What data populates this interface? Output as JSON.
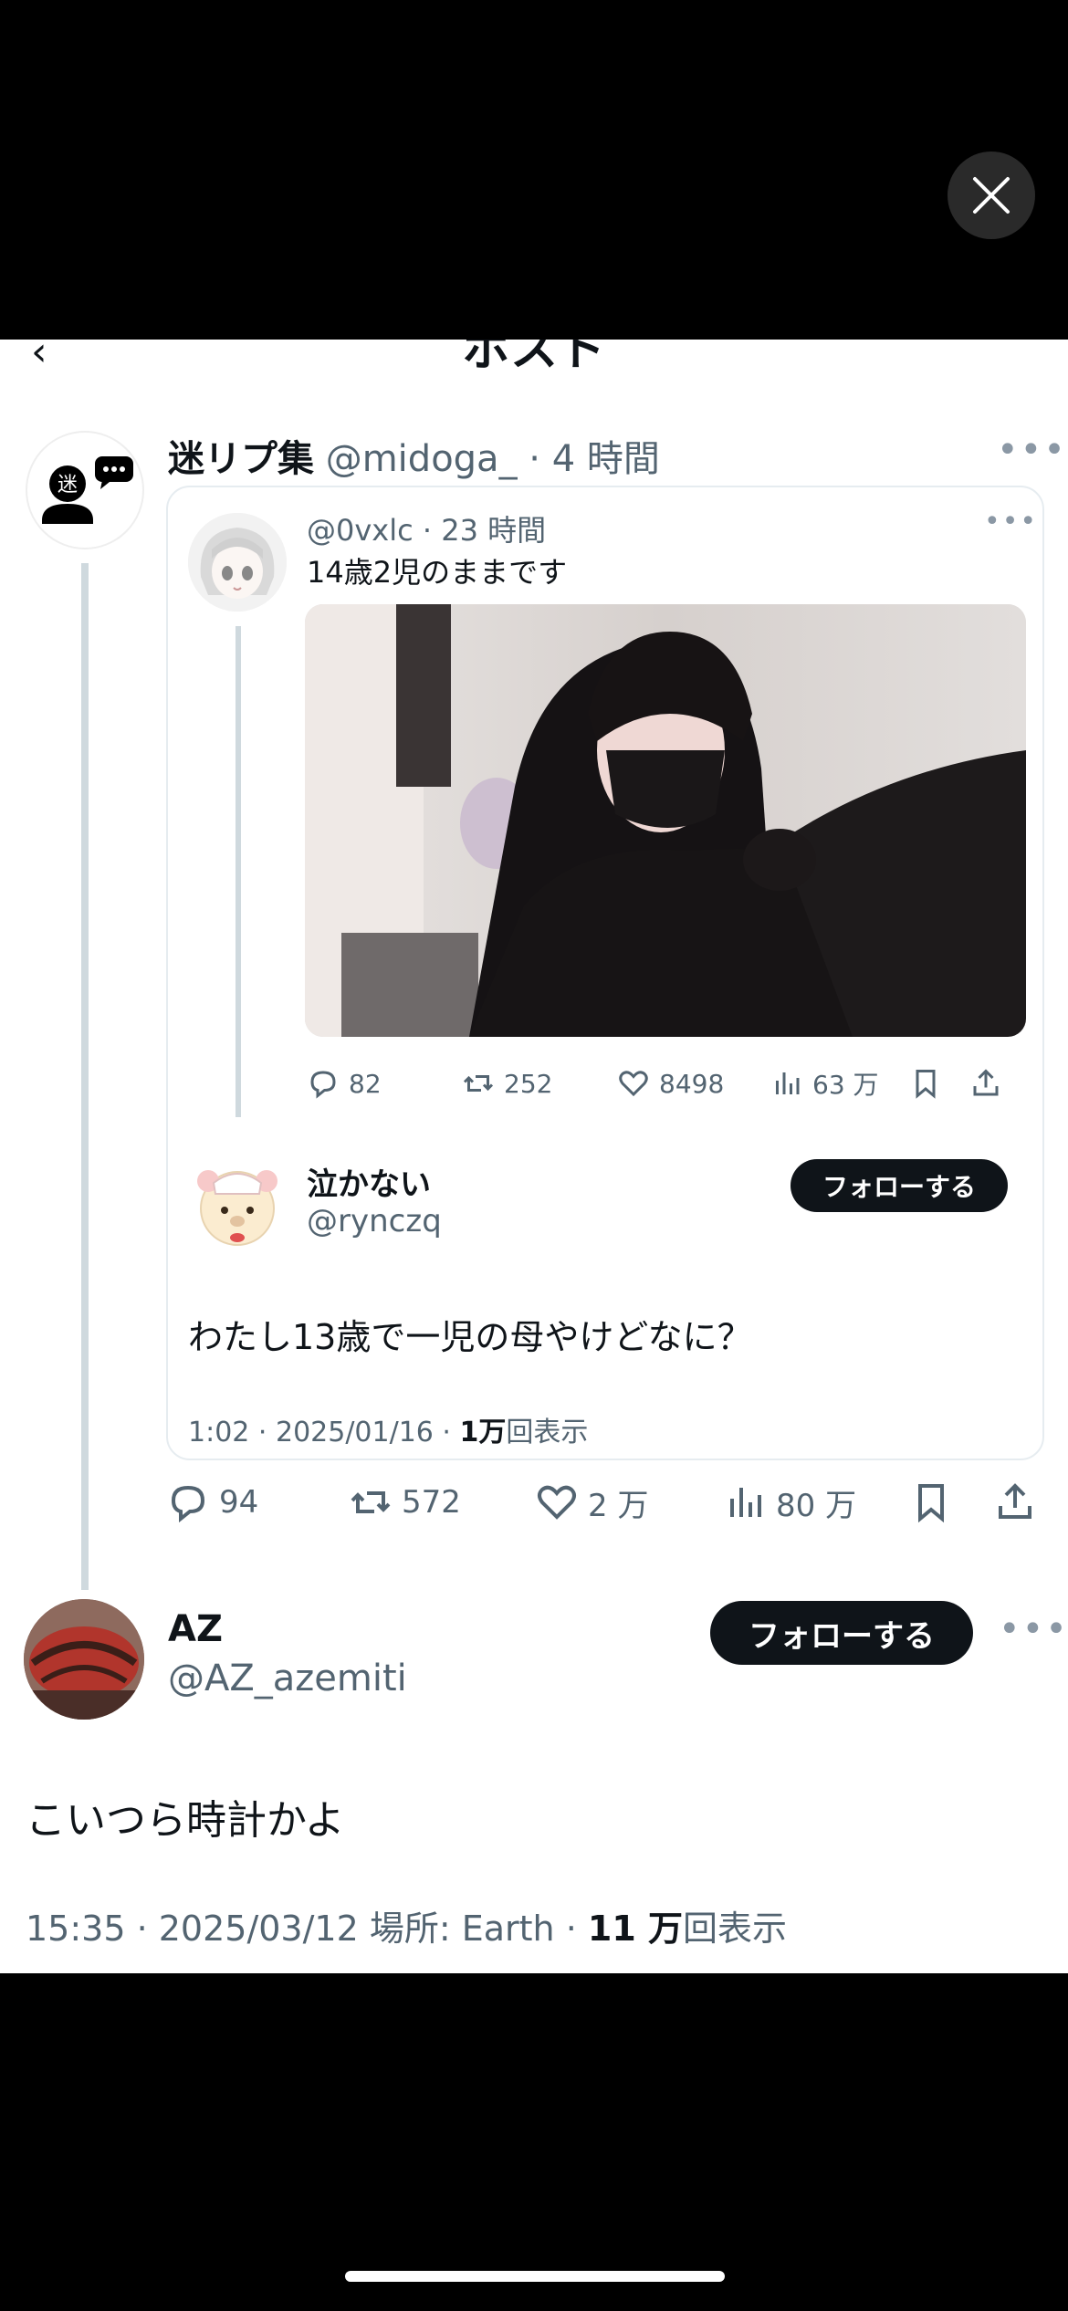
{
  "viewer": {
    "close_icon": "close-icon"
  },
  "header": {
    "back_icon": "chevron-left-icon",
    "title": "ポスト"
  },
  "main_post": {
    "avatar_text": "迷",
    "display_name": "迷リプ集",
    "handle_meta": "@midoga_ · 4 時間",
    "more_label": "•••"
  },
  "quoted": {
    "meta": "@0vxlc · 23 時間",
    "text": "14歳2児のままです",
    "actions": {
      "replies": "82",
      "reposts": "252",
      "likes": "8498",
      "views": "63 万"
    },
    "more_label": "•••",
    "reply": {
      "display_name": "泣かない",
      "handle": "@rynczq",
      "follow_label": "フォローする",
      "text": "わたし13歳で一児の母やけどなに？",
      "meta_time": "1:02 · 2025/01/16 · ",
      "meta_views": "1万",
      "meta_views_suffix": "回表示"
    }
  },
  "main_actions": {
    "replies": "94",
    "reposts": "572",
    "likes": "2 万",
    "views": "80 万"
  },
  "reply_post": {
    "display_name": "AZ",
    "handle": "@AZ_azemiti",
    "follow_label": "フォローする",
    "more_label": "•••",
    "text": "こいつら時計かよ",
    "meta_time": "15:35 · 2025/03/12 場所: Earth · ",
    "meta_views": "11 万",
    "meta_views_suffix": "回表示"
  },
  "colors": {
    "text": "#0f1419",
    "secondary": "#536471",
    "border": "#e6ecf0",
    "thread": "#cfd9de"
  }
}
